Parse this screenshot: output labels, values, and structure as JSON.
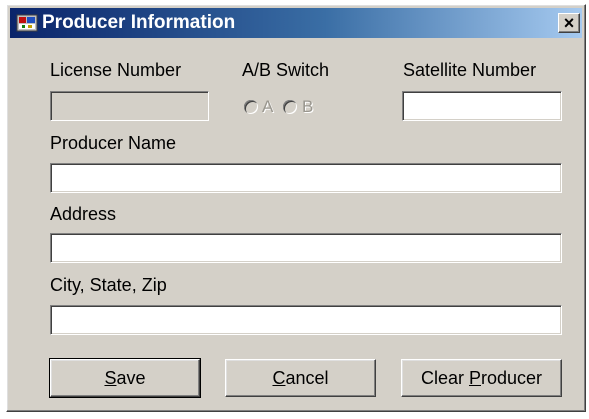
{
  "window": {
    "title": "Producer Information",
    "close_label": "×"
  },
  "labels": {
    "license_number": "License Number",
    "ab_switch": "A/B Switch",
    "satellite_number": "Satellite Number",
    "producer_name": "Producer Name",
    "address": "Address",
    "city_state_zip": "City, State, Zip"
  },
  "ab_switch": {
    "options": [
      "A",
      "B"
    ],
    "enabled": false,
    "selected": null
  },
  "fields": {
    "license_number": "",
    "satellite_number": "",
    "producer_name": "",
    "address": "",
    "city_state_zip": ""
  },
  "buttons": {
    "save": {
      "pre": "",
      "mnemonic": "S",
      "post": "ave"
    },
    "cancel": {
      "pre": "",
      "mnemonic": "C",
      "post": "ancel"
    },
    "clear_producer": {
      "pre": "Clear ",
      "mnemonic": "P",
      "post": "roducer"
    }
  },
  "icons": {
    "app": "app-icon",
    "close": "close-icon"
  }
}
